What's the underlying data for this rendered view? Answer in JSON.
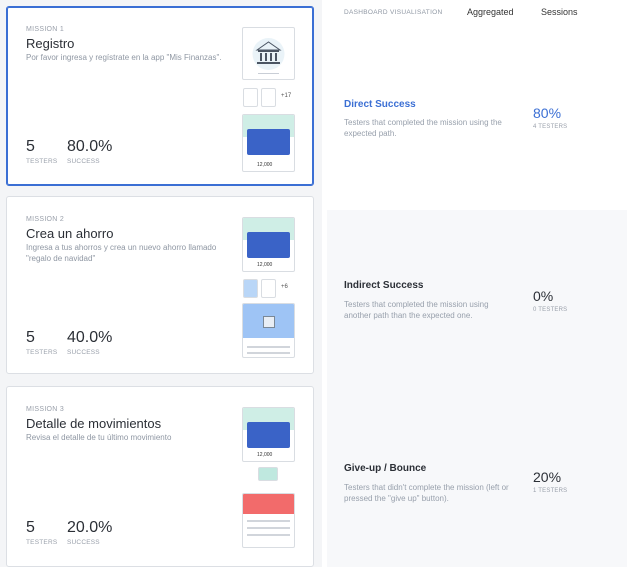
{
  "missions": [
    {
      "label": "MISSION 1",
      "title": "Registro",
      "description": "Por favor ingresa y regístrate en la app \"Mis Finanzas\".",
      "testers_value": "5",
      "testers_label": "TESTERS",
      "success_value": "80.0%",
      "success_label": "SUCCESS",
      "more_count": "+17"
    },
    {
      "label": "MISSION 2",
      "title": "Crea un ahorro",
      "description": "Ingresa a tus ahorros y crea un nuevo ahorro llamado \"regalo de navidad\"",
      "testers_value": "5",
      "testers_label": "TESTERS",
      "success_value": "40.0%",
      "success_label": "SUCCESS",
      "more_count": "+6"
    },
    {
      "label": "MISSION 3",
      "title": "Detalle de movimientos",
      "description": "Revisa el detalle de tu último movimiento",
      "testers_value": "5",
      "testers_label": "TESTERS",
      "success_value": "20.0%",
      "success_label": "SUCCESS"
    }
  ],
  "tabs": {
    "title": "DASHBOARD VISUALISATION",
    "aggregated": "Aggregated",
    "sessions": "Sessions"
  },
  "results": [
    {
      "title": "Direct Success",
      "description": "Testers that completed the mission using the expected path.",
      "percent": "80%",
      "testers": "4 TESTERS",
      "color": "#3b6fd4"
    },
    {
      "title": "Indirect Success",
      "description": "Testers that completed the mission using another path than the expected one.",
      "percent": "0%",
      "testers": "0 TESTERS",
      "color": "#2b2f36"
    },
    {
      "title": "Give-up / Bounce",
      "description": "Testers that didn't complete the mission (left or pressed the \"give up\" button).",
      "percent": "20%",
      "testers": "1 TESTERS",
      "color": "#2b2f36"
    }
  ],
  "colors": {
    "accent": "#3b6fd4",
    "card_blue": "#3a63c7",
    "mint": "#cfeee6",
    "coral": "#f26b6b"
  },
  "icons": [
    "bank-icon",
    "screen-thumbnail"
  ]
}
